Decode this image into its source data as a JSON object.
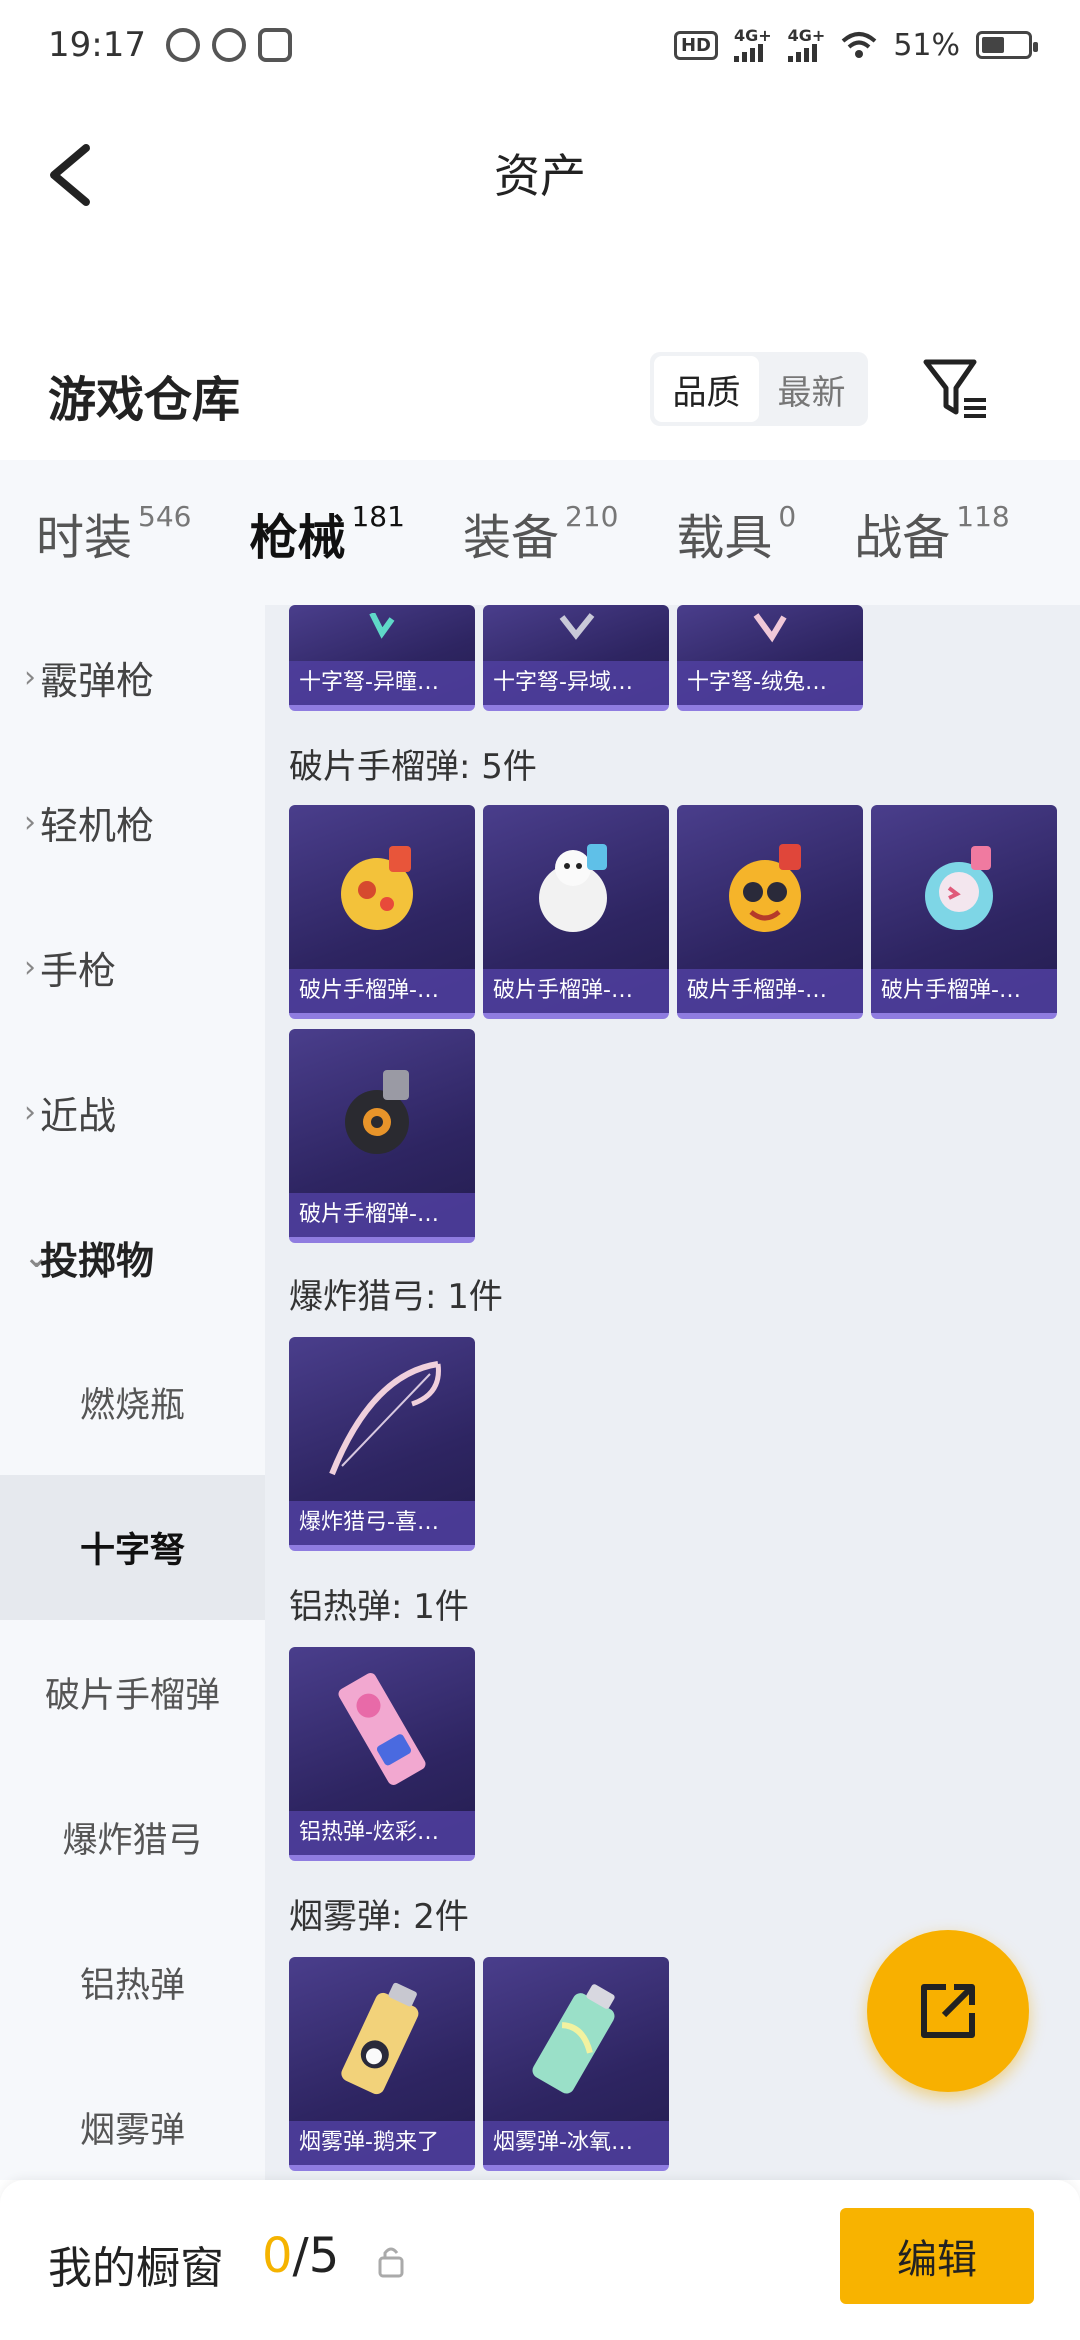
{
  "status_bar": {
    "time": "19:17",
    "hd": "HD",
    "sig1": "4G+",
    "sig2": "4G+",
    "battery": "51%",
    "battery_level": 0.51
  },
  "header": {
    "title": "资产"
  },
  "warehouse": {
    "title": "游戏仓库",
    "sort_options": [
      "品质",
      "最新"
    ],
    "active_sort": "品质"
  },
  "tabs": [
    {
      "label": "时装",
      "count": "546"
    },
    {
      "label": "枪械",
      "count": "181"
    },
    {
      "label": "装备",
      "count": "210"
    },
    {
      "label": "载具",
      "count": "0"
    },
    {
      "label": "战备",
      "count": "118"
    }
  ],
  "sidebar": {
    "categories": [
      "霰弹枪",
      "轻机枪",
      "手枪",
      "近战",
      "投掷物"
    ],
    "subitems": [
      "燃烧瓶",
      "十字弩",
      "破片手榴弹",
      "爆炸猎弓",
      "铝热弹",
      "烟雾弹"
    ],
    "selected": "十字弩"
  },
  "content": {
    "top_row": [
      "十字弩-异瞳…",
      "十字弩-异域…",
      "十字弩-绒兔…"
    ],
    "groups": [
      {
        "label": "破片手榴弹: 5件",
        "items": [
          "破片手榴弹-…",
          "破片手榴弹-…",
          "破片手榴弹-…",
          "破片手榴弹-…",
          "破片手榴弹-…"
        ]
      },
      {
        "label": "爆炸猎弓: 1件",
        "items": [
          "爆炸猎弓-喜…"
        ]
      },
      {
        "label": "铝热弹: 1件",
        "items": [
          "铝热弹-炫彩…"
        ]
      },
      {
        "label": "烟雾弹: 2件",
        "items": [
          "烟雾弹-鹅来了",
          "烟雾弹-冰氧…"
        ]
      }
    ]
  },
  "bottom": {
    "showcase_label": "我的橱窗",
    "current": "0",
    "total": "/5",
    "edit_label": "编辑"
  },
  "colors": {
    "accent": "#f8b300",
    "card_bg": "#2e2562"
  }
}
